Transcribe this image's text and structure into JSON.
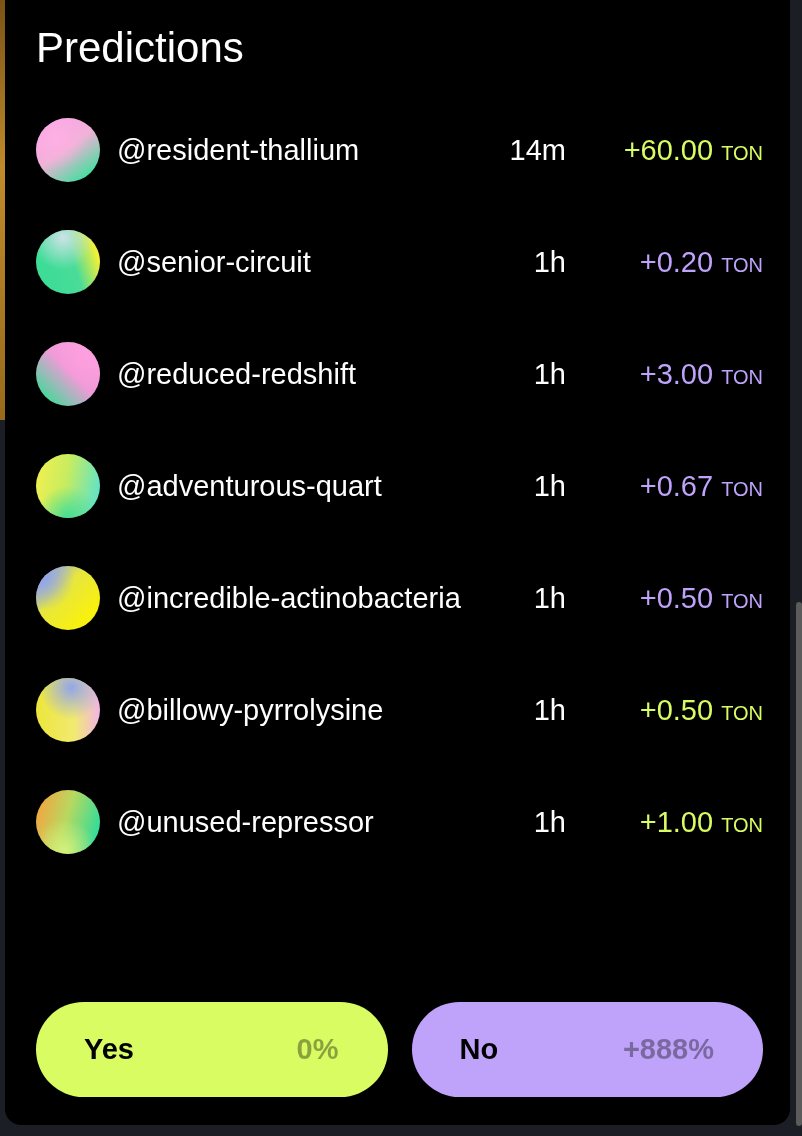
{
  "title": "Predictions",
  "predictions": [
    {
      "user": "@resident-thallium",
      "time": "14m",
      "amount": "+60.00",
      "unit": "TON",
      "color": "#d8fc62"
    },
    {
      "user": "@senior-circuit",
      "time": "1h",
      "amount": "+0.20",
      "unit": "TON",
      "color": "#bfa3fb"
    },
    {
      "user": "@reduced-redshift",
      "time": "1h",
      "amount": "+3.00",
      "unit": "TON",
      "color": "#bfa3fb"
    },
    {
      "user": "@adventurous-quart",
      "time": "1h",
      "amount": "+0.67",
      "unit": "TON",
      "color": "#bfa3fb"
    },
    {
      "user": "@incredible-actinobacteria",
      "time": "1h",
      "amount": "+0.50",
      "unit": "TON",
      "color": "#bfa3fb"
    },
    {
      "user": "@billowy-pyrrolysine",
      "time": "1h",
      "amount": "+0.50",
      "unit": "TON",
      "color": "#d8fc62"
    },
    {
      "user": "@unused-repressor",
      "time": "1h",
      "amount": "+1.00",
      "unit": "TON",
      "color": "#d8fc62"
    }
  ],
  "buttons": [
    {
      "label": "Yes",
      "percent": "0%",
      "color": "#d8fc62"
    },
    {
      "label": "No",
      "percent": "+888%",
      "color": "#bfa3fb"
    }
  ]
}
